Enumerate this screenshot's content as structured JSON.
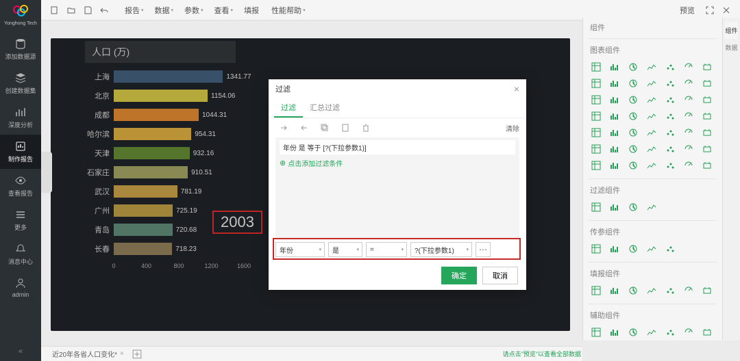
{
  "brand": "Yonghong Tech",
  "sidebar": {
    "items": [
      {
        "label": "添加数据源"
      },
      {
        "label": "创建数据集"
      },
      {
        "label": "深度分析"
      },
      {
        "label": "制作报告"
      },
      {
        "label": "查看报告"
      },
      {
        "label": "更多"
      },
      {
        "label": "消息中心"
      },
      {
        "label": "admin"
      }
    ]
  },
  "top": {
    "menus": [
      "报告",
      "数据",
      "参数",
      "查看",
      "填报",
      "性能帮助"
    ],
    "right": "预览"
  },
  "chart_data": {
    "type": "bar",
    "title": "人口 (万)",
    "categories": [
      "上海",
      "北京",
      "成都",
      "哈尔滨",
      "天津",
      "石家庄",
      "武汉",
      "广州",
      "青岛",
      "长春"
    ],
    "values": [
      1341.77,
      1154.06,
      1044.31,
      954.31,
      932.16,
      910.51,
      781.19,
      725.19,
      720.68,
      718.23
    ],
    "colors": [
      "#3b556e",
      "#bdb03e",
      "#c67a2b",
      "#c29a3a",
      "#5a7a2e",
      "#8f8f58",
      "#b08d3f",
      "#a58b3d",
      "#547a6a",
      "#7f7050"
    ],
    "xticks": [
      0,
      400,
      800,
      1200,
      1600
    ],
    "xmax": 1600,
    "year_badge": "2003"
  },
  "modal": {
    "title": "过滤",
    "tabs": [
      "过滤",
      "汇总过滤"
    ],
    "clear": "清除",
    "condition_text": "年份 是 等于 [?(下拉参数1)]",
    "add_text": "点击添加过滤条件",
    "selects": {
      "field": "年份",
      "is": "是",
      "op": "=",
      "value": "?(下拉参数1)"
    },
    "ok": "确定",
    "cancel": "取消"
  },
  "rpanel": {
    "header": "组件",
    "sections": [
      "图表组件",
      "过滤组件",
      "传参组件",
      "填报组件",
      "辅助组件"
    ],
    "rtabs": [
      "组件",
      "数据"
    ]
  },
  "footer": {
    "tab": "近20年各省人口变化*",
    "hint": "请点击\"预览\"以查看全部数据"
  }
}
